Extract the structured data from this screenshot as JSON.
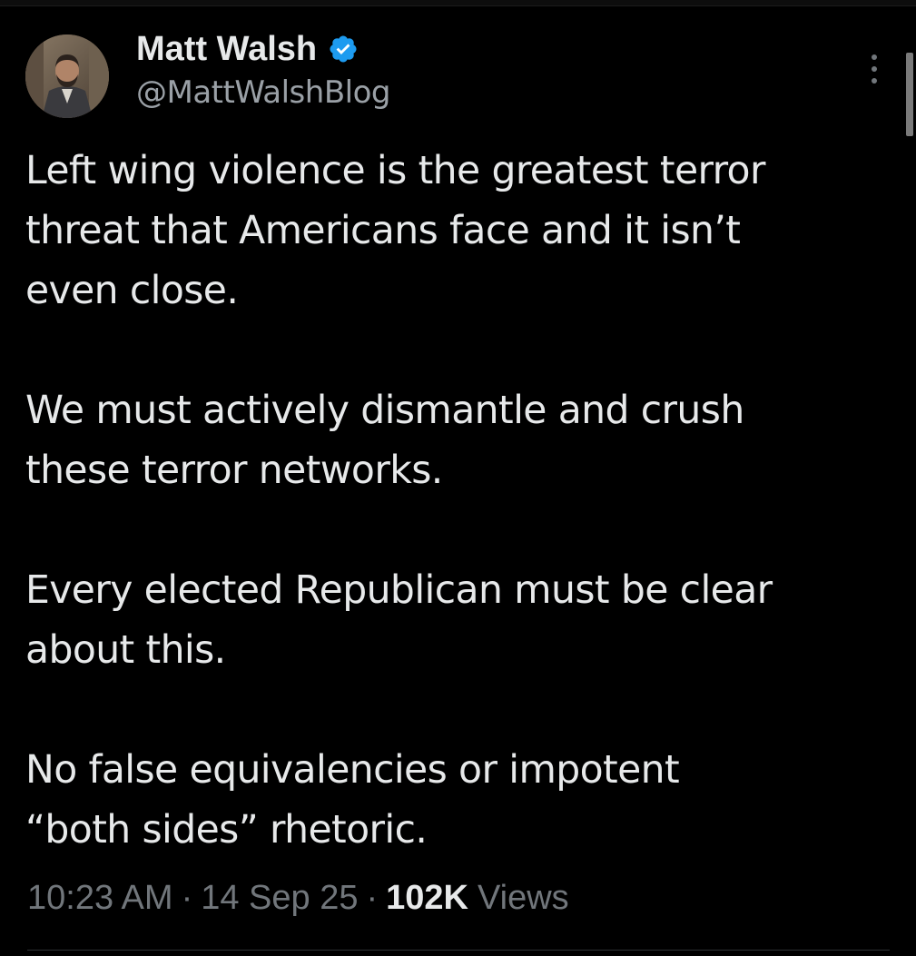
{
  "colors": {
    "background": "#000000",
    "primary_text": "#e7e9ea",
    "secondary_text": "#71767b",
    "verified_badge": "#1d9bf0"
  },
  "author": {
    "display_name": "Matt Walsh",
    "handle": "@MattWalshBlog",
    "verified_icon": "verified-badge-icon",
    "avatar_icon": "avatar"
  },
  "tweet": {
    "paragraphs": [
      "Left wing violence is the greatest terror\nthreat that Americans face and it isn’t\neven close.",
      "We must actively dismantle and crush\nthese terror networks.",
      "Every elected Republican must be clear\nabout this.",
      "No false equivalencies or impotent\n“both sides” rhetoric."
    ]
  },
  "meta": {
    "time": "10:23 AM",
    "separator": "·",
    "date": "14 Sep 25",
    "views_count": "102K",
    "views_label": "Views"
  },
  "more_icon": "more-vertical-icon"
}
